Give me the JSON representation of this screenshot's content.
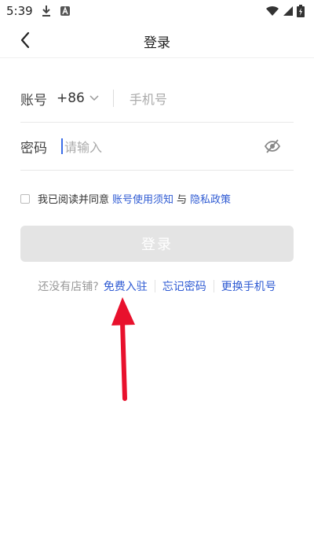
{
  "status_bar": {
    "time": "5:39",
    "icons": [
      "download-icon",
      "notification-icon",
      "wifi-icon",
      "signal-icon",
      "battery-icon"
    ]
  },
  "nav": {
    "title": "登录"
  },
  "form": {
    "account_label": "账号",
    "country_code": "+86",
    "phone_placeholder": "手机号",
    "password_label": "密码",
    "password_placeholder": "请输入"
  },
  "agreement": {
    "text": "我已阅读并同意",
    "terms_link": "账号使用须知",
    "and": "与",
    "privacy_link": "隐私政策",
    "checked": false
  },
  "login_button": {
    "label": "登录"
  },
  "links": {
    "no_store": "还没有店铺?",
    "register": "免费入驻",
    "forgot_password": "忘记密码",
    "change_phone": "更换手机号"
  },
  "colors": {
    "link": "#2f5bd3",
    "button_disabled": "#e4e4e4",
    "annotation_arrow": "#e8112d"
  }
}
